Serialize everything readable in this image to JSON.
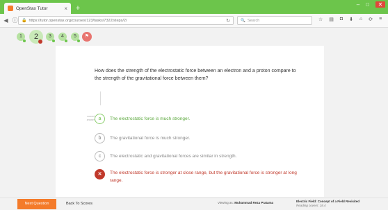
{
  "browser": {
    "tab_title": "OpenStax Tutor",
    "tab_close": "×",
    "new_tab": "+",
    "url": "https://tutor.openstax.org/courses/123/tasks/7322/steps/2/",
    "search_placeholder": "Search",
    "window_buttons": [
      "–",
      "□",
      "✕"
    ],
    "toolbar_icons": [
      "star-icon",
      "reading-list-icon",
      "pocket-icon",
      "download-icon",
      "home-icon",
      "sync-icon",
      "menu-icon"
    ]
  },
  "steps": [
    {
      "label": "1",
      "status": "complete"
    },
    {
      "label": "2",
      "status": "current"
    },
    {
      "label": "3",
      "status": "complete"
    },
    {
      "label": "4",
      "status": "complete"
    },
    {
      "label": "5",
      "status": "complete"
    },
    {
      "label": "",
      "status": "end"
    }
  ],
  "question": {
    "text": "How does the strength of the electrostatic force between an electron and a proton compare to the strength of the gravitational force between them?",
    "correct_label": "correct answer",
    "answers": [
      {
        "letter": "a",
        "text": "The electrostatic force is much stronger.",
        "state": "correct"
      },
      {
        "letter": "b",
        "text": "The gravitational force is much stronger.",
        "state": "neutral"
      },
      {
        "letter": "c",
        "text": "The electrostatic and gravitational forces are similar in strength.",
        "state": "neutral"
      },
      {
        "letter": "✕",
        "text": "The electrostatic force is stronger at close range, but the gravitational force is stronger at long range.",
        "state": "wrong"
      }
    ]
  },
  "footer": {
    "next_label": "Next Question",
    "back_label": "Back To Scores",
    "viewing_prefix": "Viewing as:",
    "viewing_name": "Muhammad Reza Pratama",
    "topic": "Electric Field: Concept of a Field Revisited",
    "coverage": "Reading covers: 18.4"
  },
  "colors": {
    "chrome_green": "#6cc54b",
    "accent_orange": "#f47b2a",
    "correct_green": "#5ba83d",
    "wrong_red": "#c0392b"
  }
}
